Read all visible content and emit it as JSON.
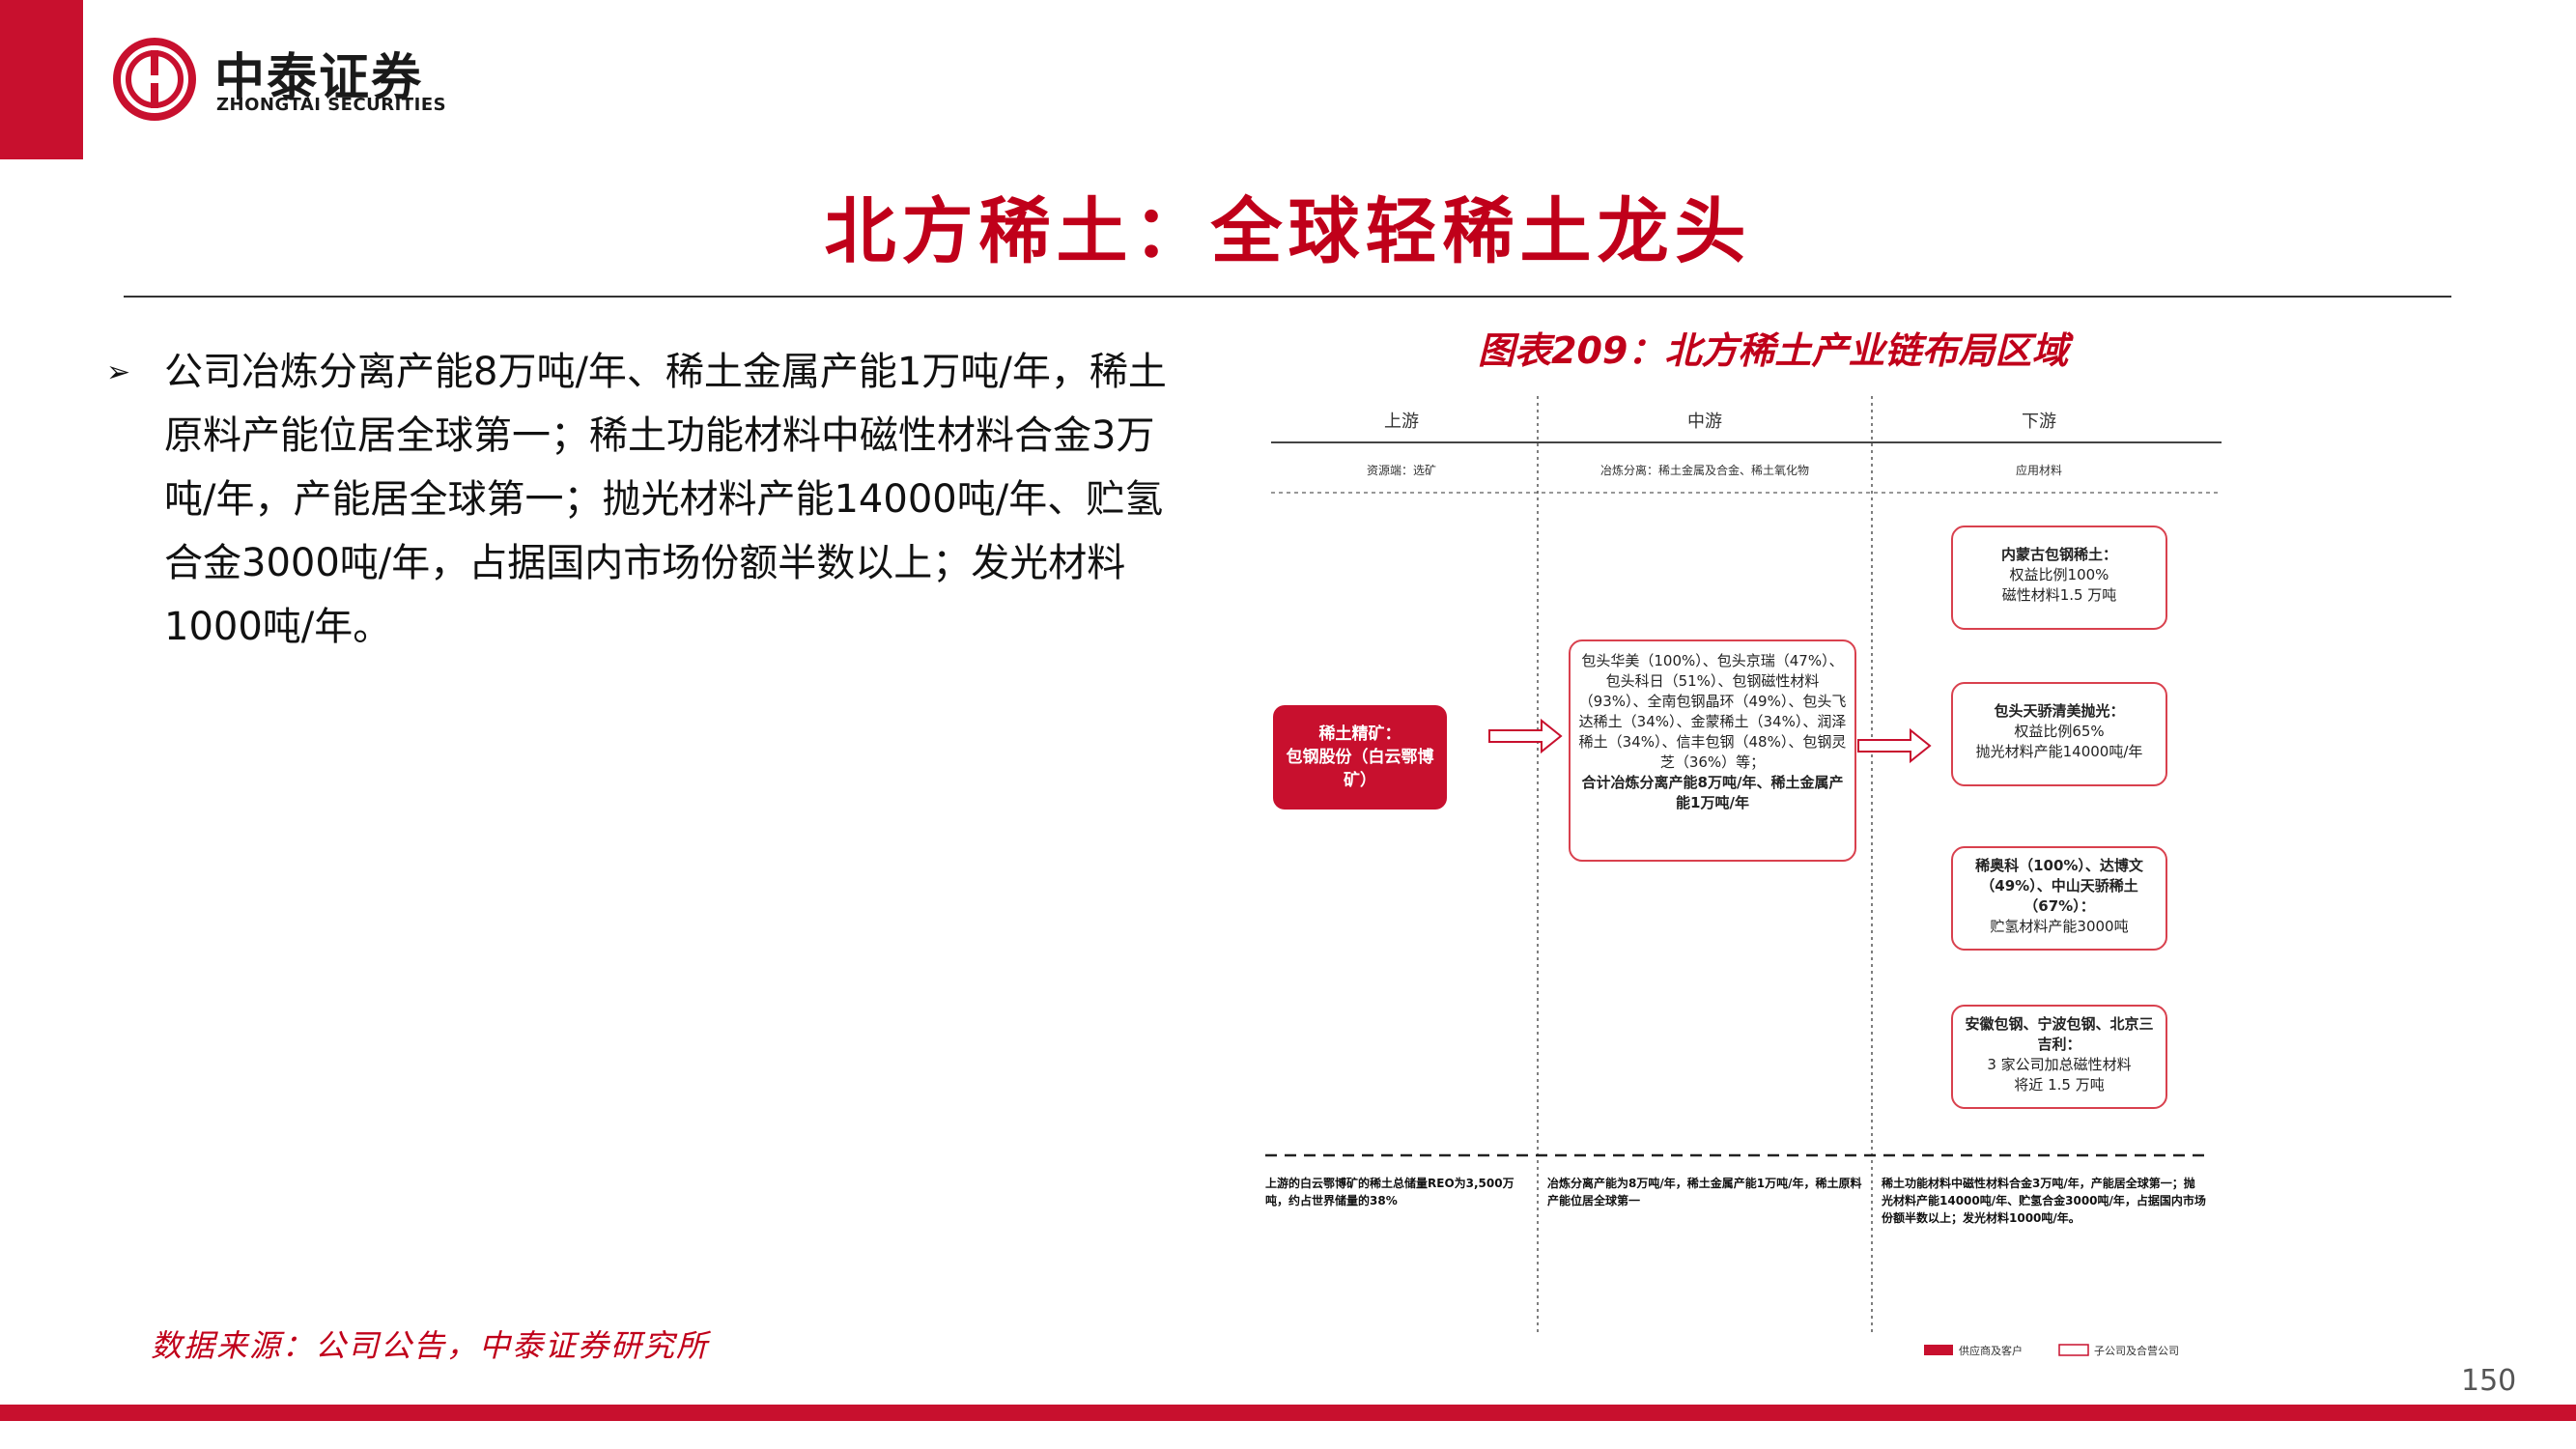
{
  "header": {
    "logo_cn": "中泰证券",
    "logo_en": "ZHONGTAI SECURITIES",
    "brand_color": "#c8102e"
  },
  "title": "北方稀土：全球轻稀土龙头",
  "bullet": {
    "text": "公司冶炼分离产能8万吨/年、稀土金属产能1万吨/年，稀土原料产能位居全球第一；稀土功能材料中磁性材料合金3万吨/年，产能居全球第一；抛光材料产能14000吨/年、贮氢合金3000吨/年，占据国内市场份额半数以上；发光材料1000吨/年。"
  },
  "figure": {
    "title": "图表209：北方稀土产业链布局区域",
    "columns": [
      "上游",
      "中游",
      "下游"
    ],
    "subheaders": [
      "资源端：选矿",
      "冶炼分离：稀土金属及合金、稀土氧化物",
      "应用材料"
    ],
    "upstream_box": {
      "line1": "稀土精矿：",
      "line2": "包钢股份（白云鄂博矿）"
    },
    "midstream_box": {
      "text": "包头华美（100%）、包头京瑞（47%）、包头科日（51%）、包钢磁性材料（93%）、全南包钢晶环（49%）、包头飞达稀土（34%）、金蒙稀土（34%）、润泽稀土（34%）、信丰包钢（48%）、包钢灵芝（36%）等；",
      "bold": "合计冶炼分离产能8万吨/年、稀土金属产能1万吨/年"
    },
    "downstream_boxes": [
      {
        "title": "内蒙古包钢稀土：",
        "lines": [
          "权益比例100%",
          "磁性材料1.5 万吨"
        ]
      },
      {
        "title": "包头天骄清美抛光：",
        "lines": [
          "权益比例65%",
          "抛光材料产能14000吨/年"
        ]
      },
      {
        "title": "稀奥科（100%）、达博文（49%）、中山天骄稀土（67%）：",
        "lines": [
          "贮氢材料产能3000吨"
        ]
      },
      {
        "title": "安徽包钢、宁波包钢、北京三吉利：",
        "lines": [
          "3 家公司加总磁性材料",
          "将近 1.5 万吨"
        ]
      }
    ],
    "notes": [
      "上游的白云鄂博矿的稀土总储量REO为3,500万吨，约占世界储量的38%",
      "冶炼分离产能为8万吨/年，稀土金属产能1万吨/年，稀土原料产能位居全球第一",
      "稀土功能材料中磁性材料合金3万吨/年，产能居全球第一；抛光材料产能14000吨/年、贮氢合金3000吨/年，占据国内市场份额半数以上；发光材料1000吨/年。"
    ],
    "legend": [
      {
        "label": "供应商及客户",
        "style": "filled"
      },
      {
        "label": "子公司及合营公司",
        "style": "outline"
      }
    ]
  },
  "source": "数据来源：公司公告，中泰证券研究所",
  "page_number": "150"
}
